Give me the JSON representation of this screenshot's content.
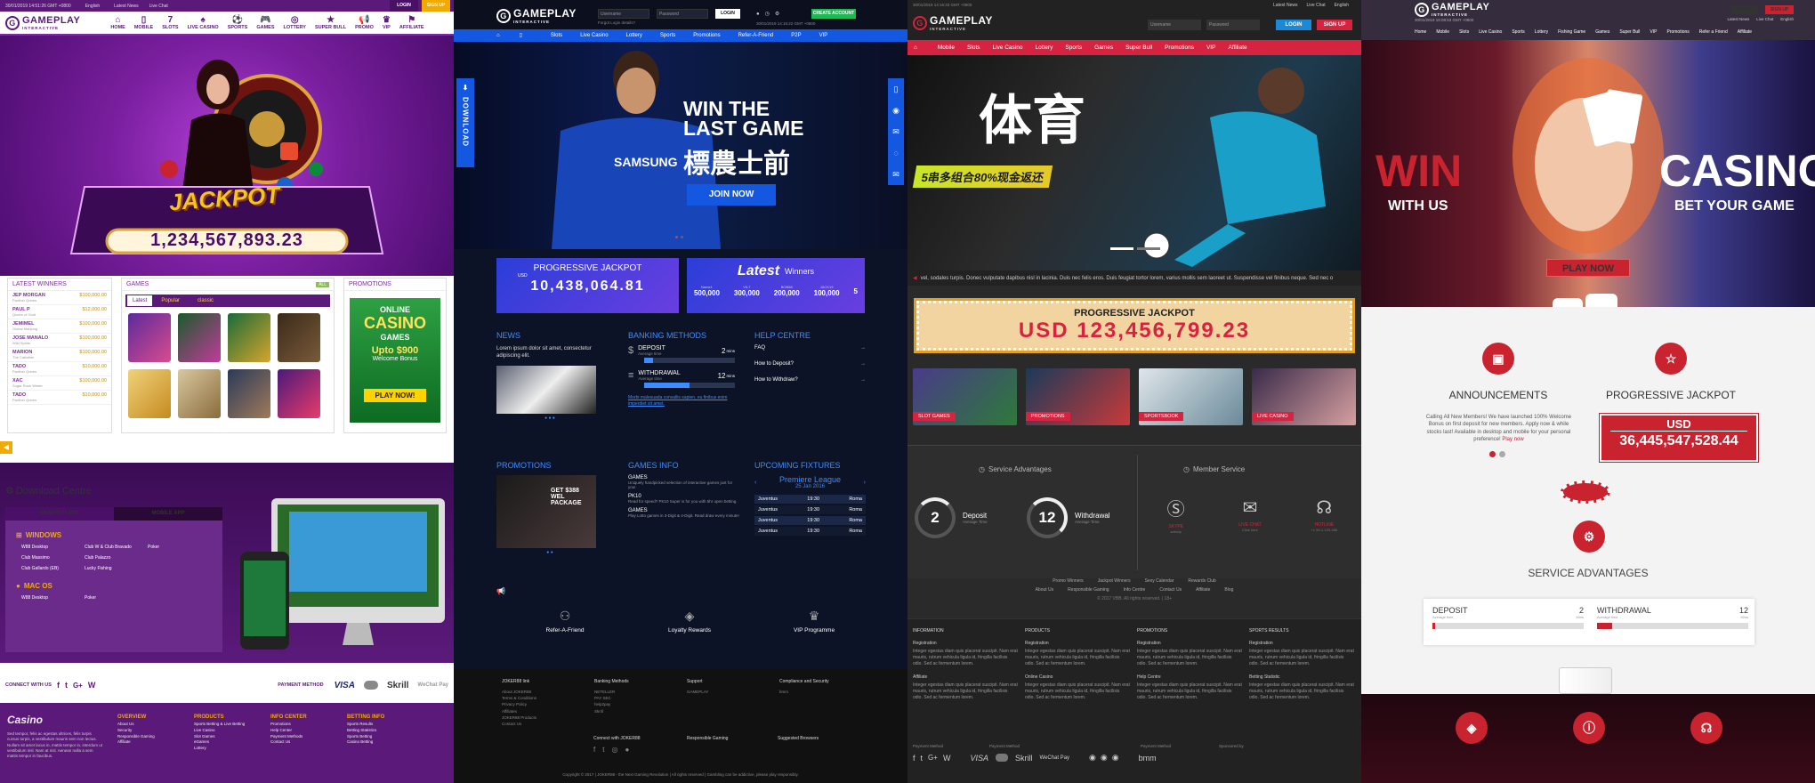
{
  "p1": {
    "topbar": {
      "datetime": "30/01/2019 14:51:26 GMT +0800",
      "lang": "English",
      "news": "Latest News",
      "chat": "Live Chat",
      "login": "LOGIN",
      "signup": "SIGN UP"
    },
    "logo": {
      "main": "GAMEPLAY",
      "sub": "INTERACTIVE"
    },
    "nav": [
      {
        "icon": "⌂",
        "label": "HOME"
      },
      {
        "icon": "▯",
        "label": "MOBILE"
      },
      {
        "icon": "7",
        "label": "SLOTS"
      },
      {
        "icon": "♠",
        "label": "LIVE CASINO"
      },
      {
        "icon": "⚽",
        "label": "SPORTS"
      },
      {
        "icon": "🎮",
        "label": "GAMES"
      },
      {
        "icon": "◎",
        "label": "LOTTERY"
      },
      {
        "icon": "★",
        "label": "SUPER BULL"
      },
      {
        "icon": "📢",
        "label": "PROMO"
      },
      {
        "icon": "♛",
        "label": "VIP"
      },
      {
        "icon": "⚑",
        "label": "AFFILIATE"
      }
    ],
    "jackpot": {
      "word": "JACKPOT",
      "amount": "1,234,567,893.23"
    },
    "winners": {
      "title": "LATEST WINNERS",
      "rows": [
        {
          "name": "JEP MORGAN",
          "game": "Panther Queen",
          "amount": "$100,000.00"
        },
        {
          "name": "PAUL P",
          "game": "Queen of Gold",
          "amount": "$12,000.00"
        },
        {
          "name": "JEMIMEL",
          "game": "Global Mahjong",
          "amount": "$100,000.00"
        },
        {
          "name": "JOSE MANALO",
          "game": "Wild Spirits",
          "amount": "$100,000.00"
        },
        {
          "name": "MARION",
          "game": "The Catfather",
          "amount": "$100,000.00"
        },
        {
          "name": "TADO",
          "game": "Panther Queen",
          "amount": "$10,000.00"
        },
        {
          "name": "XAC",
          "game": "Sugar Rush Winter",
          "amount": "$100,000.00"
        },
        {
          "name": "TADO",
          "game": "Panther Queen",
          "amount": "$10,000.00"
        }
      ]
    },
    "games": {
      "title": "GAMES",
      "all": "ALL",
      "tabs": [
        "Latest",
        "Popular",
        "classic"
      ]
    },
    "promotions": {
      "title": "PROMOTIONS",
      "online": "ONLINE",
      "casino": "CASINO",
      "games": "GAMES",
      "upto": "Upto $900",
      "welcome": "Welcome Bonus",
      "cta": "PLAY NOW!"
    },
    "download": {
      "title": "Download Centre",
      "tabs": [
        "DESKTOP APP",
        "MOBILE APP"
      ],
      "windows": "WINDOWS",
      "win_items": [
        "W88 Desktop",
        "Club Massimo",
        "Club Gallardo (EB)",
        "Club W & Club Bravado",
        "Club Palazzo",
        "Lucky Fishing",
        "Poker"
      ],
      "mac": "MAC OS",
      "mac_items": [
        "W88 Desktop",
        "Poker"
      ]
    },
    "social": {
      "connect": "CONNECT WITH US",
      "payment": "PAYMENT METHOD",
      "pay_items": [
        "VISA",
        "Skrill",
        "WeChat Pay"
      ]
    },
    "footer": {
      "brand": "Casino",
      "desc": "Sed tempor, felis ac egestas ultrices, felis turpis cursus turpis, a vestibulum mauris sem non lectus. Nullam sit amet lacus in, mattis tempor in, interdum ut vestibulum nisl. Nam at nisl. Aenean nulla a sem mattis tempor in faucibus.",
      "cols": [
        {
          "title": "OVERVIEW",
          "items": [
            "About Us",
            "Security",
            "Responsible Gaming",
            "Affiliate"
          ]
        },
        {
          "title": "PRODUCTS",
          "items": [
            "Sports Betting & Live Betting",
            "Live Casino",
            "Slot Games",
            "eGames",
            "Lottery"
          ]
        },
        {
          "title": "INFO CENTER",
          "items": [
            "Promotions",
            "Help Center",
            "Payment Methods",
            "Contact Us"
          ]
        },
        {
          "title": "BETTING INFO",
          "items": [
            "Sports Results",
            "Betting Statistics",
            "Sports Betting",
            "Casino Betting"
          ]
        }
      ]
    }
  },
  "p2": {
    "logo": {
      "main": "GAMEPLAY",
      "sub": "INTERACTIVE"
    },
    "username_ph": "Username",
    "password_ph": "Password",
    "login": "LOGIN",
    "create": "CREATE ACCOUNT",
    "forgot": "Forgot Login details?",
    "time": "30/01/2019 14:16:22 GMT +0800",
    "nav": [
      "Slots",
      "Live Casino",
      "Lottery",
      "Sports",
      "Promotions",
      "Refer-A-Friend",
      "P2P",
      "VIP"
    ],
    "hero": {
      "line1": "WIN THE",
      "line2": "LAST GAME",
      "line3": "標農士前",
      "cta": "JOIN NOW"
    },
    "download": "DOWNLOAD",
    "jackpot": {
      "title": "PROGRESSIVE JACKPOT",
      "cur": "USD",
      "amount": "10,438,064.81"
    },
    "winners": {
      "latest": "Latest",
      "label": "Winners",
      "cols": [
        {
          "l": "Name1",
          "v": "500,000"
        },
        {
          "l": "VIL7",
          "v": "300,000"
        },
        {
          "l": "BOB88",
          "v": "200,000"
        },
        {
          "l": "JACK19",
          "v": "100,000"
        },
        {
          "l": "",
          "v": "5"
        }
      ]
    },
    "news": {
      "title": "NEWS",
      "text": "Lorem ipsum dolor sit amet, consectetur adipiscing elit."
    },
    "banking": {
      "title": "BANKING METHODS",
      "deposit": "DEPOSIT",
      "avg": "Average time",
      "dep_min": "2",
      "withdrawal": "WITHDRAWAL",
      "wd_min": "12",
      "mins": "mins",
      "link": "Morbi malesuada convallis sapien, eu finibus enim imperdiet sit amet."
    },
    "help": {
      "title": "HELP CENTRE",
      "items": [
        "FAQ",
        "How to Deposit?",
        "How to Withdraw?"
      ]
    },
    "promotions": {
      "title": "PROMOTIONS",
      "text": "GET $388 WEL PACKAGE"
    },
    "games_info": {
      "title": "GAMES INFO",
      "items": [
        {
          "t": "GAMES",
          "d": "Uniquely handpicked selection of interactive games just for you!"
        },
        {
          "t": "PK10",
          "d": "Read for speed? PK10 Super is for you with 5hr open betting."
        },
        {
          "t": "GAMES",
          "d": "Play Lotto games in 3-Digit & 4-Digit. Read draw every minute!"
        }
      ]
    },
    "fixtures": {
      "title": "UPCOMING FIXTURES",
      "league": "Premiere League",
      "date": "25 Jan 2016",
      "rows": [
        {
          "t": "Juventus",
          "h": "19:30",
          "a": "Roma"
        },
        {
          "t": "Juventus",
          "h": "19:30",
          "a": "Roma"
        },
        {
          "t": "Juventus",
          "h": "19:30",
          "a": "Roma"
        },
        {
          "t": "Juventus",
          "h": "19:30",
          "a": "Roma"
        }
      ]
    },
    "features": [
      "Refer-A-Friend",
      "Loyalty Rewards",
      "VIP Programme"
    ],
    "footer": {
      "cols": [
        {
          "title": "JOKER88 link",
          "items": [
            "About JOKER88",
            "Terms & Conditions",
            "Privacy Policy",
            "Affiliates",
            "JOKER88 Products",
            "Contact Us"
          ]
        },
        {
          "title": "Banking Methods",
          "items": [
            "NETELLER",
            "PAY SEC",
            "help2pay",
            "Skrill"
          ]
        },
        {
          "title": "Support",
          "items": [
            "GAMEPLAY"
          ]
        },
        {
          "title": "Compliance and Security",
          "items": [
            "bmm"
          ]
        }
      ],
      "connect": "Connect with JOKER88",
      "responsible": "Responsible Gaming",
      "browsers": "Suggested Browsers",
      "copyright": "Copyright © 2017 | JOKER88 - the Next Gaming Revolution | All rights reserved | Gambling can be addictive, please play responsibly."
    }
  },
  "p3": {
    "logo": {
      "main": "GAMEPLAY",
      "sub": "INTERACTIVE"
    },
    "time": "30/01/2019 14:16:33 GMT +0800",
    "top_links": [
      "Latest News",
      "Live Chat",
      "English"
    ],
    "username_ph": "Username",
    "password_ph": "Password",
    "login": "LOGIN",
    "signup": "SIGN UP",
    "nav": [
      "Mobile",
      "Slots",
      "Live Casino",
      "Lottery",
      "Sports",
      "Games",
      "Super Bull",
      "Promotions",
      "VIP",
      "Affiliate"
    ],
    "hero": {
      "title": "体育",
      "banner": "5串多组合80%现金返还"
    },
    "ticker": "vel, sodales turpis. Donec vulputate dapibus nisl in lacinia. Duis nec felis eros. Duis feugiat tortor lorem, varius mollis sem laoreet ut. Suspendisse vel finibus neque. Sed nec o",
    "jackpot": {
      "title": "PROGRESSIVE JACKPOT",
      "amount": "USD 123,456,799.23"
    },
    "tiles": [
      "SLOT GAMES",
      "PROMOTIONS",
      "SPORTSBOOK",
      "LIVE CASINO"
    ],
    "service": {
      "title": "Service Advantages",
      "deposit": "Deposit",
      "dep_num": "2",
      "withdrawal": "Withdrawal",
      "wd_num": "12",
      "avg": "Average Time"
    },
    "member": {
      "title": "Member Service",
      "items": [
        {
          "t": "SKYPE",
          "s": "sdelvip"
        },
        {
          "t": "LIVE CHAT",
          "s": "Click here"
        },
        {
          "t": "HOTLINE",
          "s": "+1 55-1-123-456"
        }
      ]
    },
    "links1": [
      "Promo Winners",
      "Jackpot Winners",
      "Sexy Calendar",
      "Rewards Club"
    ],
    "links2": [
      "About Us",
      "Responsible Gaming",
      "Info Centre",
      "Contact Us",
      "Affiliate",
      "Blog"
    ],
    "copyright": "© 2017 VBB. All rights reserved. | 18+",
    "footer_cols": [
      {
        "title": "INFORMATION",
        "sub1": "Registration",
        "sub2": "Affiliate",
        "text": "Integer egestas diam quis placerat suscipit. Nam erat mauris, rutrum vehicula ligula id, fringilla facilisis odio. Sed ac fermentum lorem."
      },
      {
        "title": "PRODUCTS",
        "sub1": "Registration",
        "sub2": "Online Casino",
        "text": "Integer egestas diam quis placerat suscipit. Nam erat mauris, rutrum vehicula ligula id, fringilla facilisis odio. Sed ac fermentum lorem."
      },
      {
        "title": "PROMOTIONS",
        "sub1": "Registration",
        "sub2": "Help Centre",
        "text": "Integer egestas diam quis placerat suscipit. Nam erat mauris, rutrum vehicula ligula id, fringilla facilisis odio. Sed ac fermentum lorem."
      },
      {
        "title": "SPORTS RESULTS",
        "sub1": "Registration",
        "sub2": "Betting Statistic",
        "text": "Integer egestas diam quis placerat suscipit. Nam erat mauris, rutrum vehicula ligula id, fringilla facilisis odio. Sed ac fermentum lorem."
      }
    ],
    "pay1": "Payment Method",
    "pay2": "Payment Method",
    "pay3": "Payment Method",
    "sponsored": "Sponsored by",
    "pay_items": [
      "VISA",
      "Skrill",
      "WeChat Pay",
      "bmm"
    ]
  },
  "p4": {
    "logo": {
      "main": "GAMEPLAY",
      "sub": "INTERACTIVE"
    },
    "time": "30/01/2019 15:08:53 GMT +0800",
    "login": "LOGIN",
    "signup": "SIGN UP",
    "top_links": [
      "Latest News",
      "Live Chat",
      "English"
    ],
    "nav": [
      "Home",
      "Mobile",
      "Slots",
      "Live Casino",
      "Sports",
      "Lottery",
      "Fishing Game",
      "Games",
      "Super Bull",
      "VIP",
      "Promotions",
      "Refer a Friend",
      "Affiliate"
    ],
    "hero": {
      "win": "WIN",
      "withus": "WITH US",
      "casino": "CASINO",
      "bet": "BET YOUR GAME",
      "cta": "PLAY NOW"
    },
    "announce": {
      "title": "ANNOUNCEMENTS",
      "text": "Calling All New Members! We have launched 100% Welcome Bonus on first deposit for new members. Apply now & while stocks last! Available in desktop and mobile for your personal preference!",
      "link": "Play now"
    },
    "jackpot": {
      "title": "PROGRESSIVE JACKPOT",
      "cur": "USD",
      "amount": "36,445,547,528.44"
    },
    "service": {
      "title": "SERVICE ADVANTAGES",
      "deposit": "DEPOSIT",
      "dep_num": "2",
      "withdrawal": "WITHDRAWAL",
      "wd_num": "12",
      "avg": "Average time",
      "mins": "Mins",
      "dep_fill": 0.02,
      "wd_fill": 0.1
    }
  },
  "colors": {
    "purple": "#5b1a7a",
    "blue": "#1457e0",
    "red": "#d6233f",
    "crimson": "#c9232f",
    "gold": "#f5c518"
  }
}
